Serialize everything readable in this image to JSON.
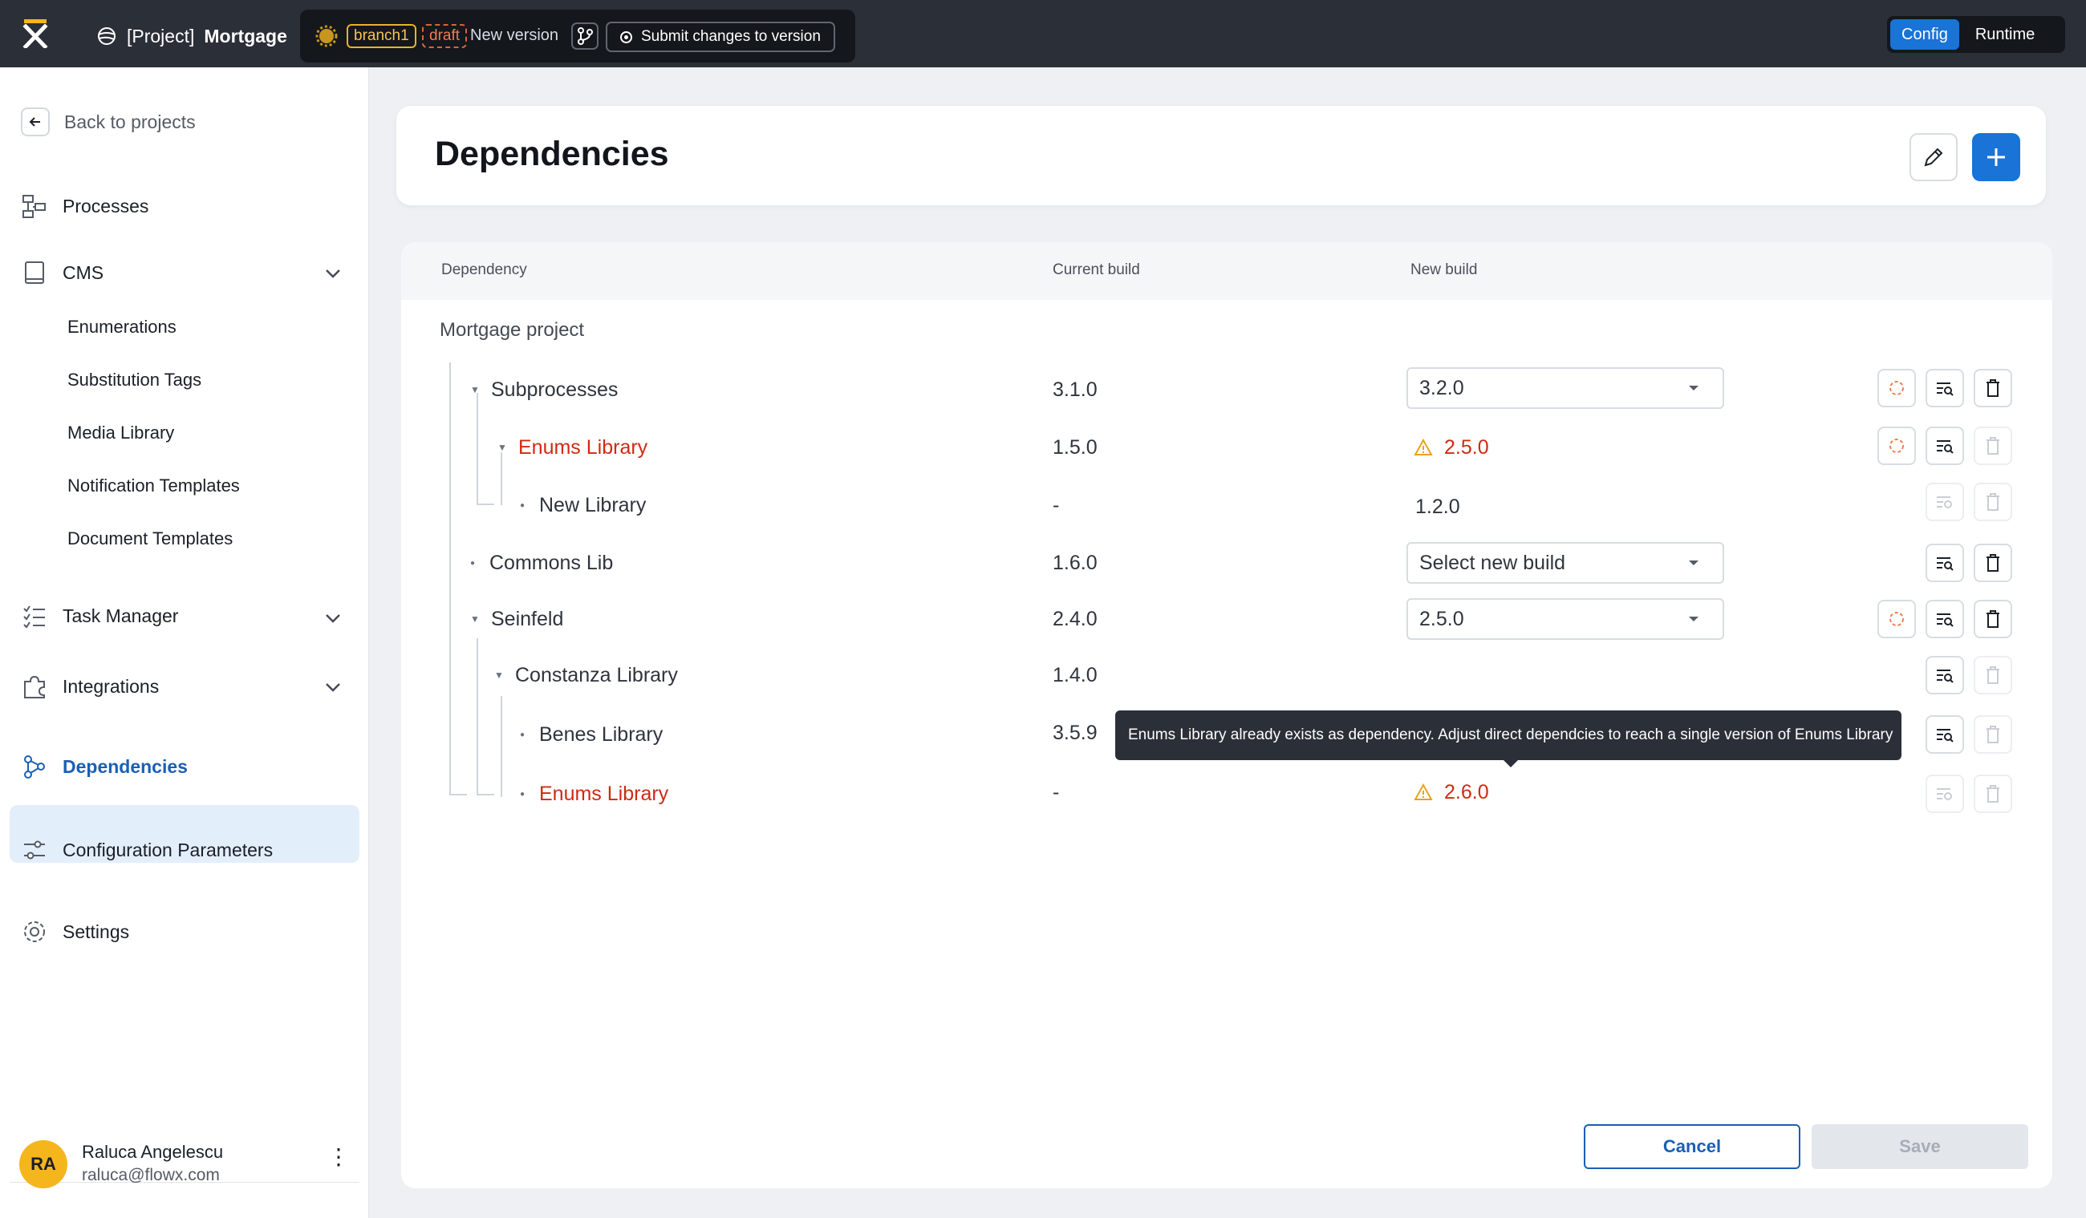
{
  "topbar": {
    "project_prefix": "[Project]",
    "project_name": "Mortgage",
    "branch": "branch1",
    "draft": "draft",
    "new_version": "New version",
    "submit_label": "Submit changes to version",
    "modes": [
      "Config",
      "Runtime"
    ],
    "active_mode": "Config"
  },
  "sidebar": {
    "back_label": "Back to projects",
    "items": [
      {
        "label": "Processes",
        "icon": "processes-icon"
      },
      {
        "label": "CMS",
        "icon": "book-icon"
      },
      {
        "label": "Task Manager",
        "icon": "checklist-icon"
      },
      {
        "label": "Integrations",
        "icon": "puzzle-icon"
      },
      {
        "label": "Dependencies",
        "icon": "dependencies-icon"
      },
      {
        "label": "Configuration Parameters",
        "icon": "sliders-icon"
      },
      {
        "label": "Settings",
        "icon": "gear-icon"
      }
    ],
    "cms_subitems": [
      "Enumerations",
      "Substitution Tags",
      "Media Library",
      "Notification Templates",
      "Document Templates"
    ],
    "active": "Dependencies",
    "user": {
      "initials": "RA",
      "name": "Raluca Angelescu",
      "email": "raluca@flowx.com"
    }
  },
  "page": {
    "title": "Dependencies",
    "columns": [
      "Dependency",
      "Current build",
      "New build"
    ],
    "root": "Mortgage project",
    "rows": [
      {
        "name": "Subprocesses",
        "current": "3.1.0",
        "new": "3.2.0"
      },
      {
        "name": "Enums Library",
        "current": "1.5.0",
        "new": "2.5.0"
      },
      {
        "name": "New Library",
        "current": "-",
        "new": "1.2.0"
      },
      {
        "name": "Commons Lib",
        "current": "1.6.0",
        "new": "Select new build"
      },
      {
        "name": "Seinfeld",
        "current": "2.4.0",
        "new": "2.5.0"
      },
      {
        "name": "Constanza Library",
        "current": "1.4.0",
        "new": ""
      },
      {
        "name": "Benes Library",
        "current": "3.5.9",
        "new": ""
      },
      {
        "name": "Enums Library",
        "current": "-",
        "new": "2.6.0"
      }
    ],
    "tooltip": "Enums Library already exists as dependency. Adjust direct dependcies to reach a single version of Enums Library",
    "cancel_label": "Cancel",
    "save_label": "Save"
  },
  "colors": {
    "accent": "#1a73d6",
    "error": "#cf2a12",
    "warning": "#e8a317",
    "topbar": "#2b2f38"
  }
}
